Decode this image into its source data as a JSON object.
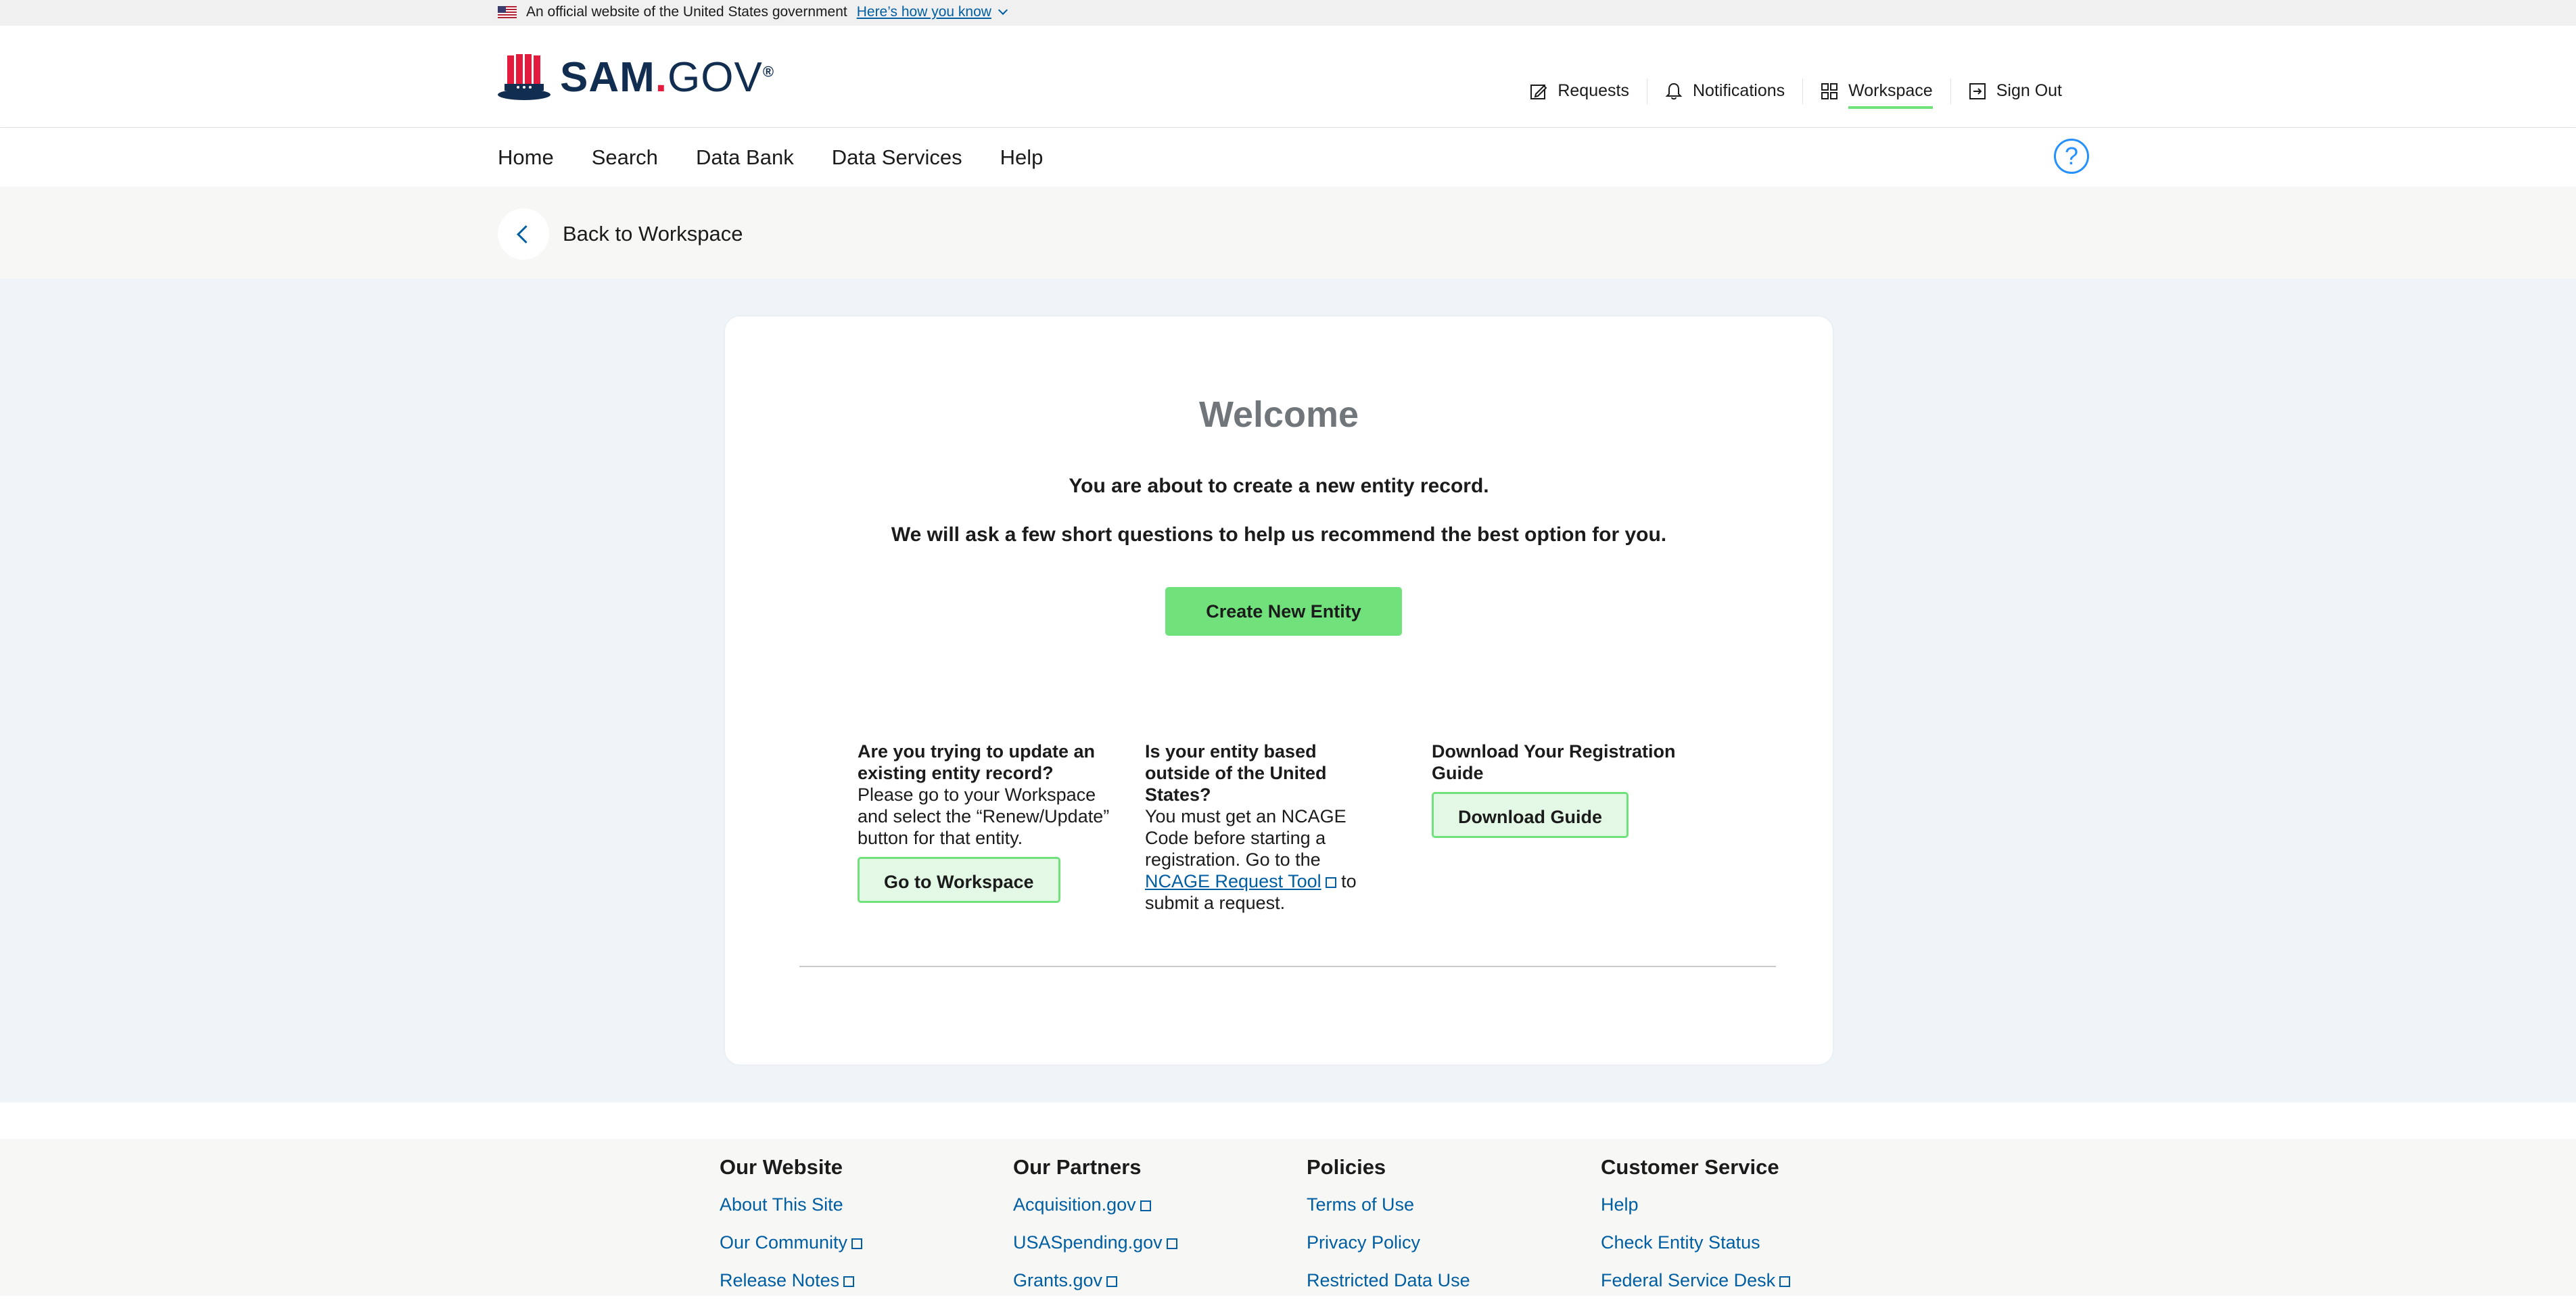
{
  "gov_banner": {
    "text": "An official website of the United States government",
    "link": "Here’s how you know"
  },
  "logo": {
    "sam": "SAM",
    "gov": "GOV",
    "reg": "®"
  },
  "top_nav": [
    {
      "label": "Requests",
      "icon": "pencil-square-icon"
    },
    {
      "label": "Notifications",
      "icon": "bell-icon"
    },
    {
      "label": "Workspace",
      "icon": "grid-icon",
      "active": true
    },
    {
      "label": "Sign Out",
      "icon": "sign-out-icon"
    }
  ],
  "main_nav": [
    "Home",
    "Search",
    "Data Bank",
    "Data Services",
    "Help"
  ],
  "help_symbol": "?",
  "back": {
    "label": "Back to Workspace"
  },
  "card": {
    "title": "Welcome",
    "lead1": "You are about to create a new entity record.",
    "lead2": "We will ask a few short questions to help us recommend the best option for you.",
    "create_button": "Create New Entity",
    "col1": {
      "question": "Are you trying to update an existing entity record?",
      "text": "Please go to your Workspace and select the “Renew/Update” button for that entity.",
      "button": "Go to Workspace"
    },
    "col2": {
      "question": "Is your entity based outside of the United States?",
      "text_before": "You must get an NCAGE Code before starting a registration. Go to the ",
      "link": "NCAGE Request Tool",
      "text_after": " to submit a request."
    },
    "col3": {
      "question": "Download Your Registration Guide",
      "button": "Download Guide"
    }
  },
  "footer": {
    "columns": [
      {
        "title": "Our Website",
        "links": [
          "About This Site",
          "Our Community",
          "Release Notes"
        ]
      },
      {
        "title": "Our Partners",
        "links": [
          "Acquisition.gov",
          "USASpending.gov",
          "Grants.gov"
        ]
      },
      {
        "title": "Policies",
        "links": [
          "Terms of Use",
          "Privacy Policy",
          "Restricted Data Use"
        ]
      },
      {
        "title": "Customer Service",
        "links": [
          "Help",
          "Check Entity Status",
          "Federal Service Desk"
        ]
      }
    ]
  },
  "colors": {
    "accent_green": "#70e17b",
    "link_blue": "#005ea2",
    "page_bg": "#eff4f9"
  }
}
